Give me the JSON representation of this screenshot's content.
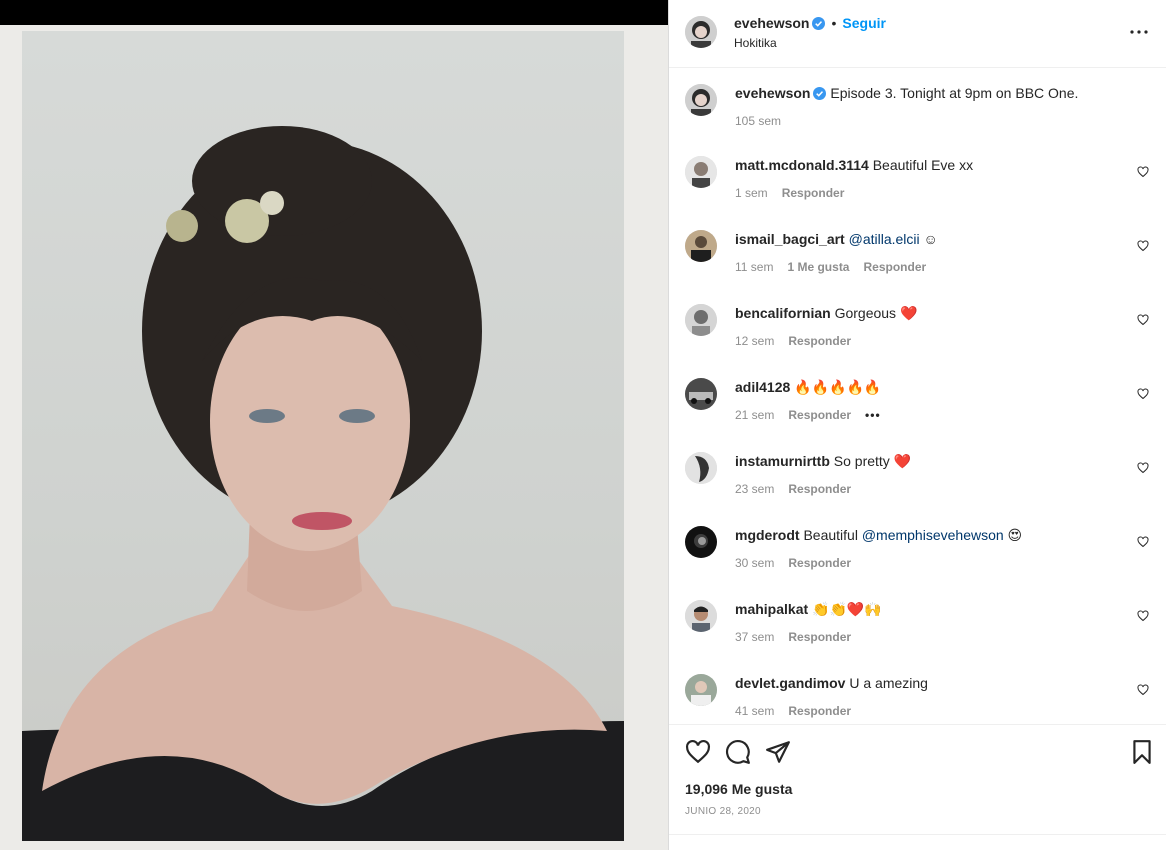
{
  "post": {
    "author": "evehewson",
    "follow_label": "Seguir",
    "location": "Hokitika",
    "caption": "Episode 3. Tonight at 9pm on BBC One.",
    "caption_time": "105 sem",
    "likes": "19,096 Me gusta",
    "date": "JUNIO 28, 2020"
  },
  "reply_label": "Responder",
  "comments": [
    {
      "user": "matt.mcdonald.3114",
      "text": "Beautiful Eve xx",
      "time": "1 sem"
    },
    {
      "user": "ismail_bagci_art",
      "mention": "@atilla.elcii",
      "text": " ☺",
      "time": "11 sem",
      "likes": "1 Me gusta"
    },
    {
      "user": "bencalifornian",
      "text": "Gorgeous ❤️",
      "time": "12 sem"
    },
    {
      "user": "adil4128",
      "text": "🔥🔥🔥🔥🔥",
      "time": "21 sem",
      "more": "•••"
    },
    {
      "user": "instamurnirttb",
      "text": "So pretty ❤️",
      "time": "23 sem"
    },
    {
      "user": "mgderodt",
      "text": "Beautiful ",
      "mention": "@memphisevehewson",
      "text2": " 😍",
      "time": "30 sem"
    },
    {
      "user": "mahipalkat",
      "text": "👏👏❤️🙌",
      "time": "37 sem"
    },
    {
      "user": "devlet.gandimov",
      "text": "U a amezing",
      "time": "41 sem"
    }
  ],
  "colors": {
    "accent": "#0095f6",
    "verified": "#3897f0",
    "heart": "#ed4956"
  }
}
